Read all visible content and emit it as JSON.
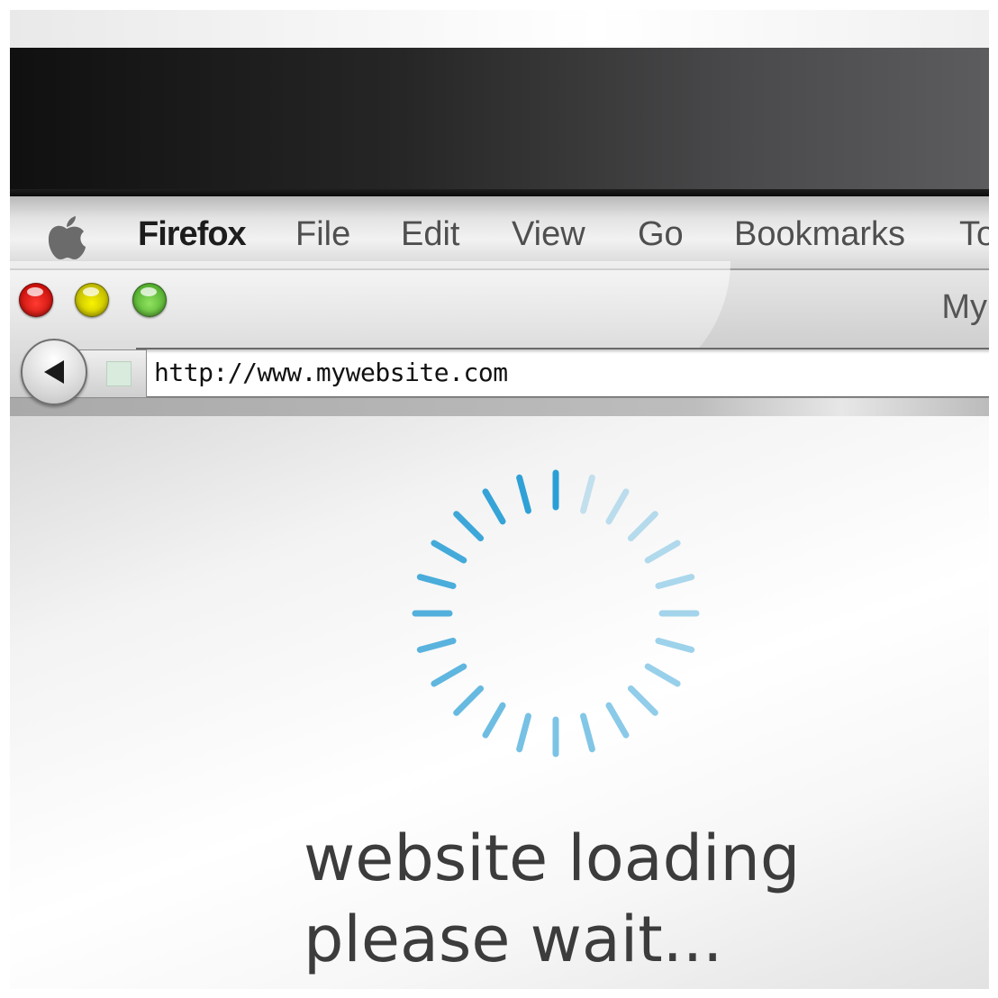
{
  "menubar": {
    "apple_icon": "apple-logo-icon",
    "app_name": "Firefox",
    "items": [
      "File",
      "Edit",
      "View",
      "Go",
      "Bookmarks",
      "To"
    ]
  },
  "window": {
    "controls": [
      "close",
      "minimize",
      "zoom"
    ],
    "control_colors": {
      "close": "#e01010",
      "minimize": "#e8e000",
      "zoom": "#6cc63e"
    },
    "tab_title": "My"
  },
  "navigation": {
    "back_icon": "back-arrow-icon",
    "stop_icon": "stop-square-icon",
    "url": "http://www.mywebsite.com"
  },
  "content": {
    "spinner_color": "#2a9fd6",
    "line1": "website loading",
    "line2": "please wait..."
  }
}
